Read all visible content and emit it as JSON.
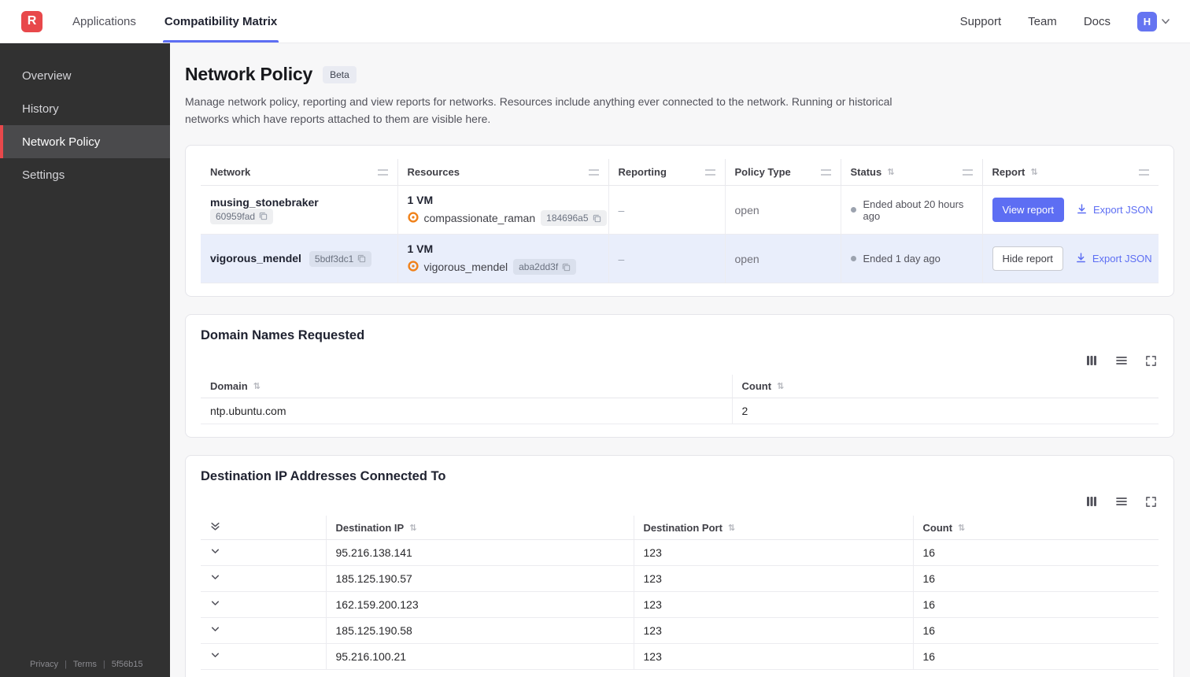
{
  "colors": {
    "accent": "#5d6ef3",
    "logo_red": "#e8484b",
    "row_highlight": "#e9eefb",
    "resource_icon_orange": "#f08119"
  },
  "topnav": {
    "logo_letter": "R",
    "items": [
      {
        "label": "Applications",
        "active": false
      },
      {
        "label": "Compatibility Matrix",
        "active": true
      }
    ],
    "right_items": [
      "Support",
      "Team",
      "Docs"
    ],
    "avatar_letter": "H"
  },
  "sidebar": {
    "items": [
      {
        "label": "Overview",
        "active": false
      },
      {
        "label": "History",
        "active": false
      },
      {
        "label": "Network Policy",
        "active": true
      },
      {
        "label": "Settings",
        "active": false
      }
    ],
    "footer": {
      "privacy": "Privacy",
      "terms": "Terms",
      "version": "5f56b15"
    }
  },
  "page": {
    "title": "Network Policy",
    "beta_badge": "Beta",
    "description": "Manage network policy, reporting and view reports for networks. Resources include anything ever connected to the network. Running or historical networks which have reports attached to them are visible here."
  },
  "network_table": {
    "columns": [
      "Network",
      "Resources",
      "Reporting",
      "Policy Type",
      "Status",
      "Report"
    ],
    "rows": [
      {
        "network_name": "musing_stonebraker",
        "network_id": "60959fad",
        "resources_title": "1 VM",
        "resource_name": "compassionate_raman",
        "resource_id": "184696a5",
        "reporting": "–",
        "policy_type": "open",
        "status": "Ended about 20 hours ago",
        "report_button": "View report",
        "export_label": "Export JSON"
      },
      {
        "network_name": "vigorous_mendel",
        "network_id": "5bdf3dc1",
        "resources_title": "1 VM",
        "resource_name": "vigorous_mendel",
        "resource_id": "aba2dd3f",
        "reporting": "–",
        "policy_type": "open",
        "status": "Ended 1 day ago",
        "report_button": "Hide report",
        "export_label": "Export JSON"
      }
    ]
  },
  "domain_card": {
    "title": "Domain Names Requested",
    "columns": [
      "Domain",
      "Count"
    ],
    "rows": [
      {
        "domain": "ntp.ubuntu.com",
        "count": "2"
      }
    ]
  },
  "dest_ip_card": {
    "title": "Destination IP Addresses Connected To",
    "columns": [
      "Destination IP",
      "Destination Port",
      "Count"
    ],
    "rows": [
      {
        "ip": "95.216.138.141",
        "port": "123",
        "count": "16"
      },
      {
        "ip": "185.125.190.57",
        "port": "123",
        "count": "16"
      },
      {
        "ip": "162.159.200.123",
        "port": "123",
        "count": "16"
      },
      {
        "ip": "185.125.190.58",
        "port": "123",
        "count": "16"
      },
      {
        "ip": "95.216.100.21",
        "port": "123",
        "count": "16"
      }
    ]
  },
  "icons": {
    "sort": "⇅",
    "copy": "copy-icon",
    "download": "download-icon",
    "resource": "vm-resource-icon",
    "columns_view": "columns-icon",
    "rows_view": "rows-icon",
    "expand_view": "expand-icon",
    "expand_all": "double-chevron-down-icon",
    "row_expander": "chevron-down-icon"
  }
}
